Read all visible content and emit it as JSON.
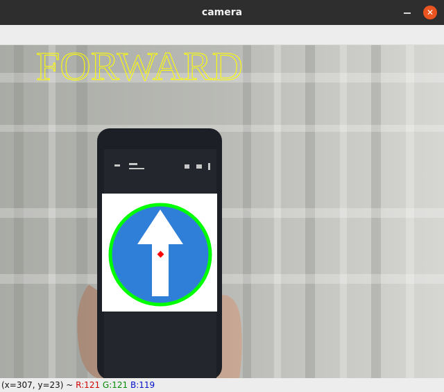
{
  "window": {
    "title": "camera",
    "close_glyph": "✕"
  },
  "overlay": {
    "label": "FORWARD"
  },
  "status": {
    "coords": "(x=307, y=23) ~ ",
    "r": "R:121",
    "g": "G:121",
    "b": "B:119"
  },
  "colors": {
    "title_bg": "#2e2e2e",
    "close": "#e95420",
    "overlay_text": "#ffff00",
    "detection_circle": "#00ff00",
    "center_marker": "#ff0000",
    "sign_blue": "#2f7fd8"
  },
  "icons": [
    "minimize-icon",
    "close-icon"
  ]
}
